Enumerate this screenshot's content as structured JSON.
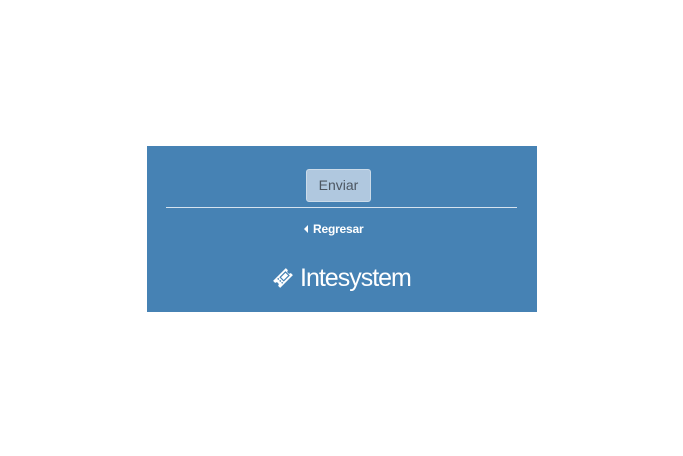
{
  "form": {
    "submit_label": "Enviar"
  },
  "navigation": {
    "back_label": "Regresar",
    "back_icon": "caret-left-icon"
  },
  "branding": {
    "logo_icon": "ticket-icon",
    "name": "Intesystem"
  },
  "colors": {
    "panel_background": "#4682b4",
    "button_background": "#b0c8df",
    "button_text": "#4c5661",
    "text_light": "#ffffff"
  }
}
